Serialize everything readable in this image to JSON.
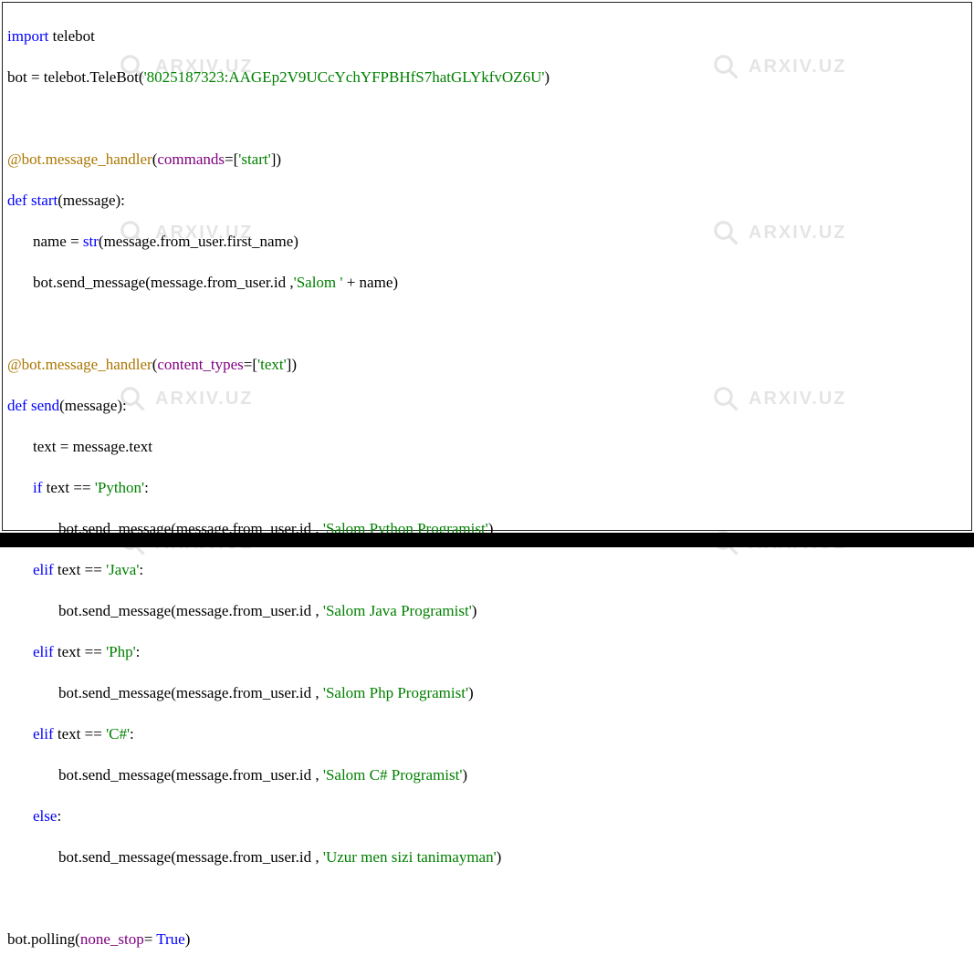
{
  "watermark": {
    "text": "ARXIV.UZ"
  },
  "code": {
    "tokens": {
      "import": "import",
      "telebot": " telebot",
      "botAssign": "bot = telebot.TeleBot(",
      "token": "'8025187323:AAGEp2V9UCcYchYFPBHfS7hatGLYkfvOZ6U'",
      "close1": ")",
      "decor": "@bot.message_handler",
      "openParen": "(",
      "commands": "commands",
      "eqBracket": "=[",
      "start": "'start'",
      "closeBr": "])",
      "def": "def",
      "sp": " ",
      "startFn": "start",
      "paramMsg": "(message):",
      "nameAssign": "name = ",
      "strFn": "str",
      "nameExpr": "(message.from_user.first_name)",
      "send1a": "bot.send_message(message.from_user.id ,",
      "salom": "'Salom '",
      "plusName": " + name)",
      "content_types": "content_types",
      "textLit": "'text'",
      "sendFn": "send",
      "textAssign": "text = message.text",
      "if": "if",
      "elif": "elif",
      "else": "else",
      "textEq": " text == ",
      "colon": ":",
      "python": "'Python'",
      "java": "'Java'",
      "php": "'Php'",
      "csharp": "'C#'",
      "sendCall": "bot.send_message(message.from_user.id , ",
      "msgPython": "'Salom Python Programist'",
      "msgJava": "'Salom Java Programist'",
      "msgPhp": "'Salom Php Programist'",
      "msgCsharp": "'Salom C# Programist'",
      "msgUnknown": "'Uzur men sizi tanimayman'",
      "closeParen": ")",
      "polling": "bot.polling(",
      "none_stop": "none_stop",
      "eq": "= ",
      "true": "True"
    }
  }
}
